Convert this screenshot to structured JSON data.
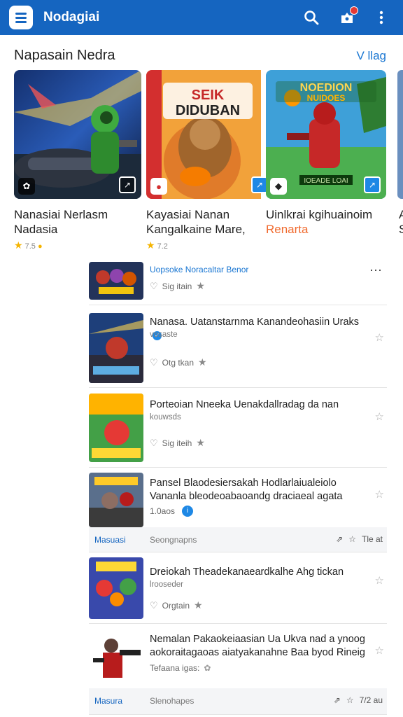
{
  "header": {
    "title": "Nodagiai",
    "accent_color": "#1565c0",
    "icons": [
      "menu-icon",
      "search-icon",
      "notification-icon",
      "more-vert-icon"
    ]
  },
  "featured": {
    "title": "Napasain Nedra",
    "view_all": "V llag",
    "cards": [
      {
        "line1": "Nanasiai Nerlasm",
        "line2": "Nadasia",
        "rating": "7.5"
      },
      {
        "line1": "Kayasiai Nanan",
        "line2": "Kangalkaine Mare,",
        "rating": "7.2"
      },
      {
        "line1": "Uinlkrai  kgihuainoim",
        "line2": "Renarta",
        "rating": ""
      }
    ],
    "peek_text": "A S",
    "cover_text": {
      "card2_line1": "SEIK",
      "card2_line2": "DIDUBAN",
      "card3_line1": "NOEDION",
      "card3_line2": "NUIDOES",
      "card3_bottom": "IOEADE LOAI"
    }
  },
  "list": {
    "items": [
      {
        "title": "Uopsoke Noracaltar Benor",
        "sub": "",
        "meta": "Sig itain"
      },
      {
        "title": "Nanasa. Uatanstarnma Kanandeohasiin Uraks",
        "sub": "vosaste",
        "meta": "Otg tkan"
      },
      {
        "title": "Porteoian Nneeka Uenakdallradag da nan",
        "sub": "kouwsds",
        "meta": "Sig iteih"
      },
      {
        "title": "Pansel Blaodesiersakah Hodlarlaiualeiolo",
        "title2": "Vananla bleodeoabaoandg draciaeal agata",
        "sub": "",
        "meta": "1.0aos"
      },
      {
        "title": "Dreiokah Theadekanaeardkalhe Ahg tickan",
        "sub": "lrooseder",
        "meta": "Orgtain"
      },
      {
        "title": "Nemalan Pakaokeiaasian Ua Ukva nad a ynoog",
        "title2": "aokoraitagaoas aiatyakanahne Baa byod Rineig",
        "sub": "",
        "meta": "Tefaana igas:"
      }
    ],
    "footer1": {
      "left": "Masuasi",
      "mid": "Seongnapns",
      "right": "Tle at"
    },
    "footer2": {
      "left": "Masura",
      "mid": "Slenohapes",
      "right": "7/2 au"
    }
  }
}
